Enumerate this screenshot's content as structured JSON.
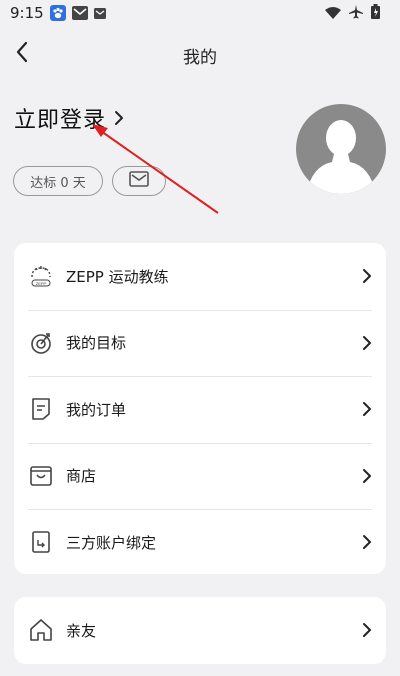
{
  "status_bar": {
    "time": "9:15",
    "icons": [
      "baidu-paw-icon",
      "mail-icon",
      "small-mail-icon",
      "wifi-icon",
      "airplane-icon",
      "battery-icon"
    ]
  },
  "header": {
    "title": "我的",
    "back_icon": "chevron-left-icon"
  },
  "profile": {
    "login_label": "立即登录",
    "days_label": "达标 0 天",
    "mail_icon": "envelope-icon",
    "avatar_icon": "default-avatar-icon"
  },
  "menu": {
    "items": [
      {
        "label": "ZEPP 运动教练",
        "icon": "zepp-coach-icon"
      },
      {
        "label": "我的目标",
        "icon": "target-icon"
      },
      {
        "label": "我的订单",
        "icon": "order-icon"
      },
      {
        "label": "商店",
        "icon": "shop-bag-icon"
      },
      {
        "label": "三方账户绑定",
        "icon": "account-link-icon"
      }
    ]
  },
  "friends": {
    "label": "亲友",
    "icon": "home-icon"
  },
  "colors": {
    "background": "#f1f1f3",
    "card": "#ffffff",
    "annotation_arrow": "#e02020",
    "avatar_bg": "#8a8a8a"
  }
}
